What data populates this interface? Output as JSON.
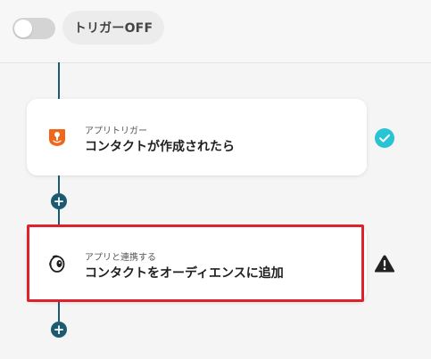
{
  "header": {
    "trigger_status_label": "トリガーOFF"
  },
  "flow": {
    "steps": [
      {
        "subtitle": "アプリトリガー",
        "title": "コンタクトが作成されたら",
        "app_icon": "hubspot-icon",
        "status_icon": "check-circle-icon"
      },
      {
        "subtitle": "アプリと連携する",
        "title": "コンタクトをオーディエンスに追加",
        "app_icon": "mailchimp-icon",
        "status_icon": "warning-icon"
      }
    ],
    "add_step_symbol": "+"
  },
  "colors": {
    "connector": "#1c5a72",
    "success": "#29c4d4",
    "highlight": "#e0212b",
    "hubspot_orange": "#f0661a",
    "warning": "#222222"
  }
}
